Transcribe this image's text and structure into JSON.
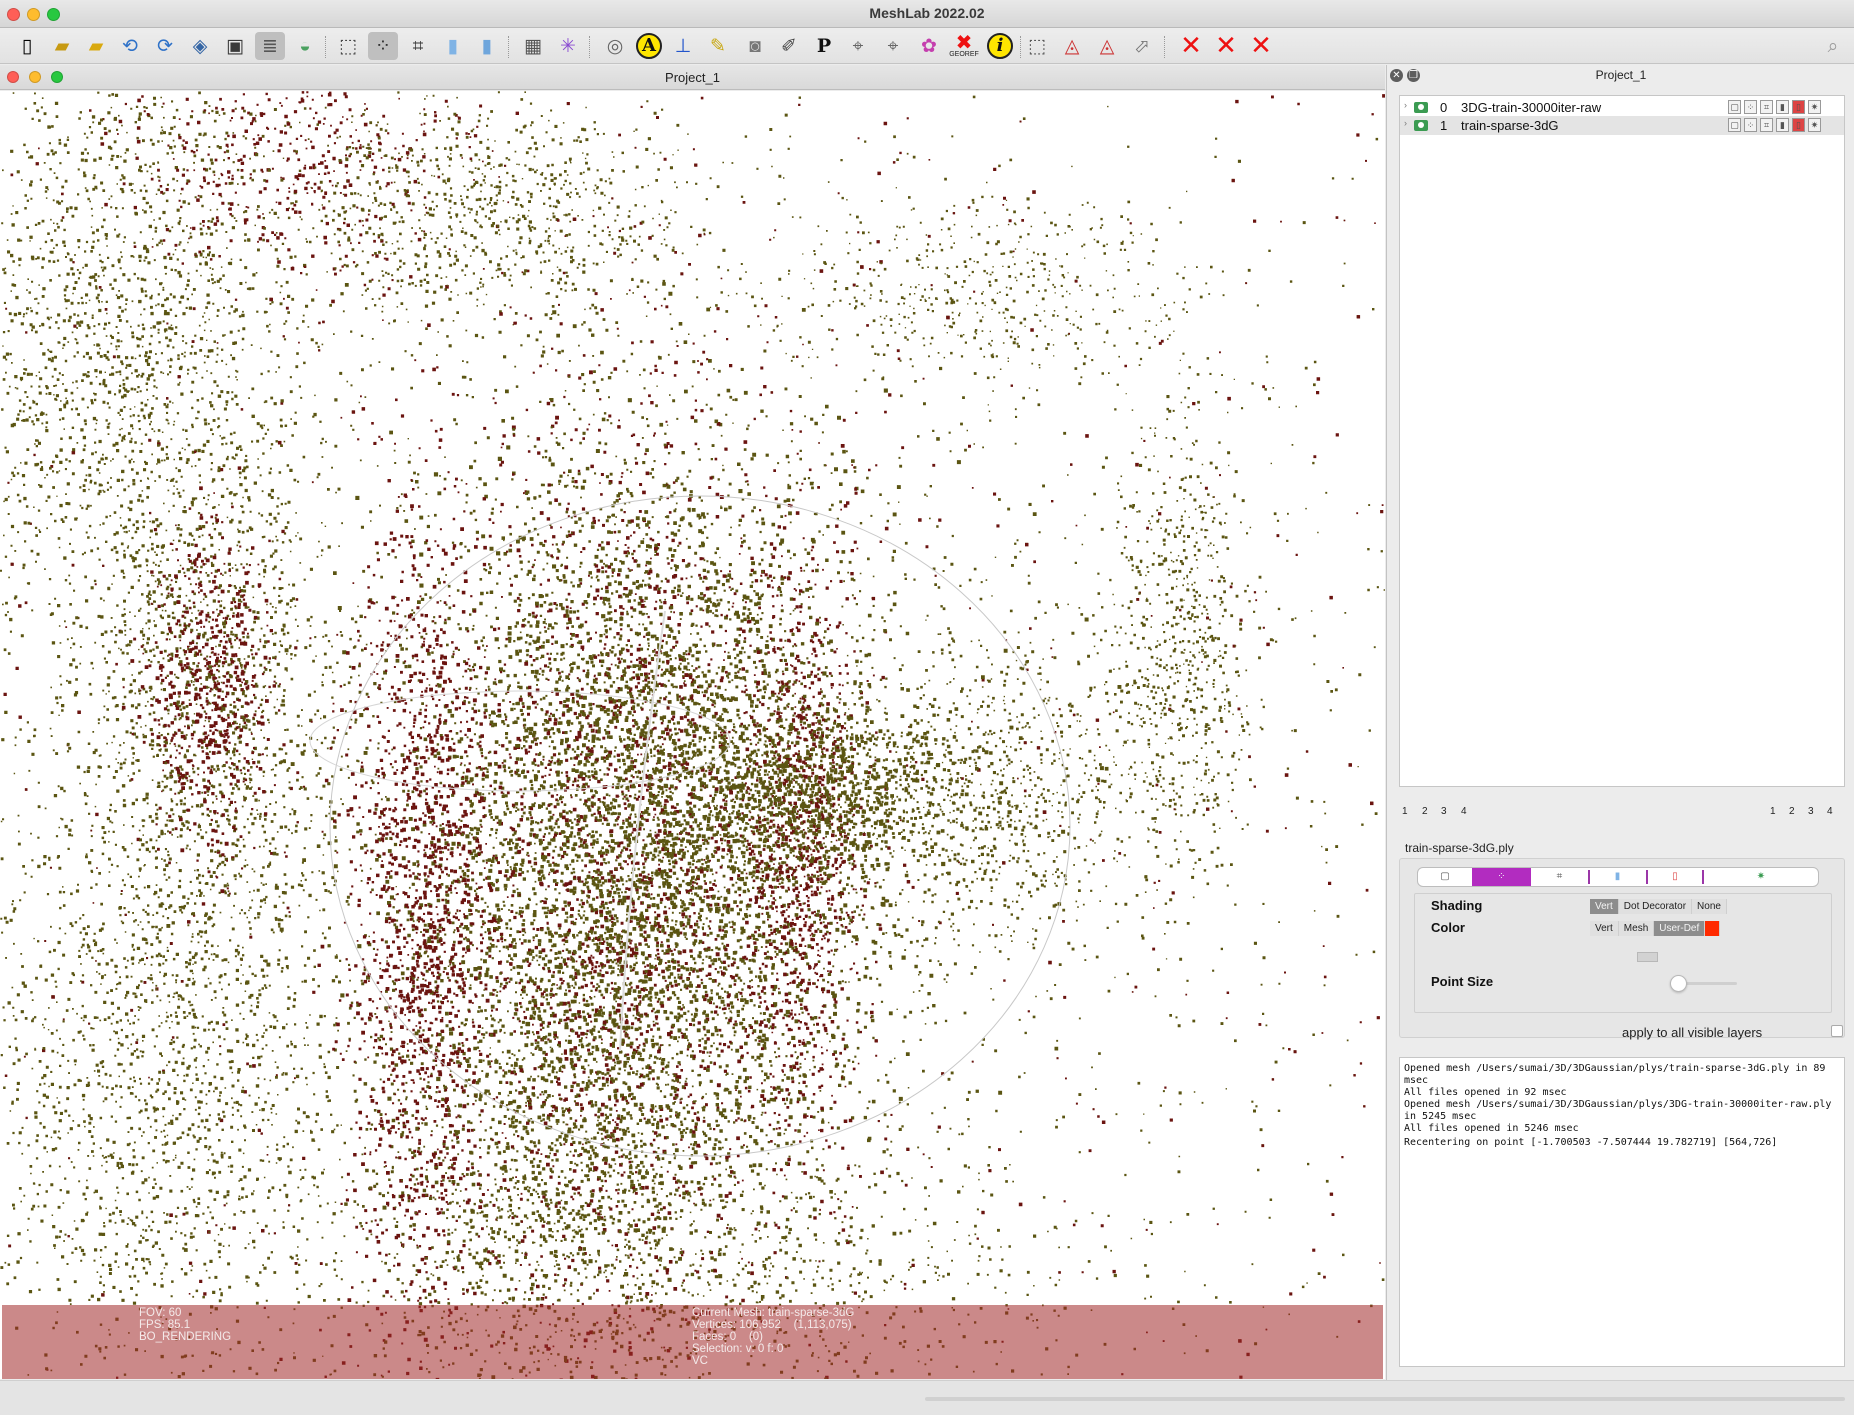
{
  "window": {
    "title": "MeshLab 2022.02",
    "colors": {
      "close": "#ff5f57",
      "minimize": "#febc2e",
      "zoom": "#28c840"
    }
  },
  "toolbar": {
    "icons": [
      "new-project-icon",
      "open-project-icon",
      "import-mesh-icon",
      "reload-icon",
      "reload-all-icon",
      "export-mesh-icon",
      "snapshot-icon",
      "layer-dialog-icon",
      "sky-view-icon",
      "bbox-render-icon",
      "points-render-icon",
      "wireframe-render-icon",
      "flat-render-icon",
      "smooth-render-icon",
      "lighting-icon",
      "axes-icon",
      "trackball-icon",
      "annotation-icon",
      "align-icon",
      "measure-icon",
      "raster-align-icon",
      "paint-icon",
      "pickpoints-icon",
      "select-vertex-icon",
      "select-faces-icon",
      "colorize-icon",
      "georef-icon",
      "info-icon",
      "select-icon",
      "select-connected-icon",
      "select-vertex-tool-icon",
      "select-area-icon",
      "delete-faces-icon",
      "delete-vertices-icon",
      "delete-all-icon"
    ],
    "letters": {
      "annotation": "A",
      "info": "i",
      "pickpoints": "P",
      "georef": "GEOREF"
    }
  },
  "viewer": {
    "title": "Project_1",
    "point_colors": {
      "dense": "#5b5512",
      "sparse": "#6b1410",
      "background": "#ffffff"
    },
    "info_left": [
      "FOV: 60",
      "FPS: 85.1",
      "BO_RENDERING"
    ],
    "info_right": [
      "Current Mesh: train-sparse-3dG",
      "Vertices: 106,952    (1,113,075)",
      "Faces: 0    (0)",
      "Selection: v: 0 f: 0",
      "VC"
    ]
  },
  "dock": {
    "title": "Project_1",
    "layers": [
      {
        "index": "0",
        "name": "3DG-train-30000iter-raw"
      },
      {
        "index": "1",
        "name": "train-sparse-3dG"
      }
    ],
    "tab_numbers_left": [
      "1",
      "2",
      "3",
      "4"
    ],
    "tab_numbers_right": [
      "1",
      "2",
      "3",
      "4"
    ],
    "selected_file": "train-sparse-3dG.ply",
    "shading": {
      "label": "Shading",
      "options": [
        "Vert",
        "Dot Decorator",
        "None"
      ],
      "selected": "Vert"
    },
    "color": {
      "label": "Color",
      "options": [
        "Vert",
        "Mesh",
        "User-Def"
      ],
      "selected": "User-Def",
      "user_color": "#ff2a00"
    },
    "point_size": {
      "label": "Point Size",
      "value": 0.0
    },
    "apply_all": {
      "label": "apply to all visible layers",
      "checked": false
    },
    "log": [
      "Opened mesh /Users/sumai/3D/3DGaussian/plys/train-sparse-3dG.ply in 89 msec",
      "All files opened in 92 msec",
      "Opened mesh /Users/sumai/3D/3DGaussian/plys/3DG-train-30000iter-raw.ply in 5245 msec",
      "All files opened in 5246 msec",
      "Recentering on point [-1.700503 -7.507444 19.782719] [564,726]"
    ]
  }
}
